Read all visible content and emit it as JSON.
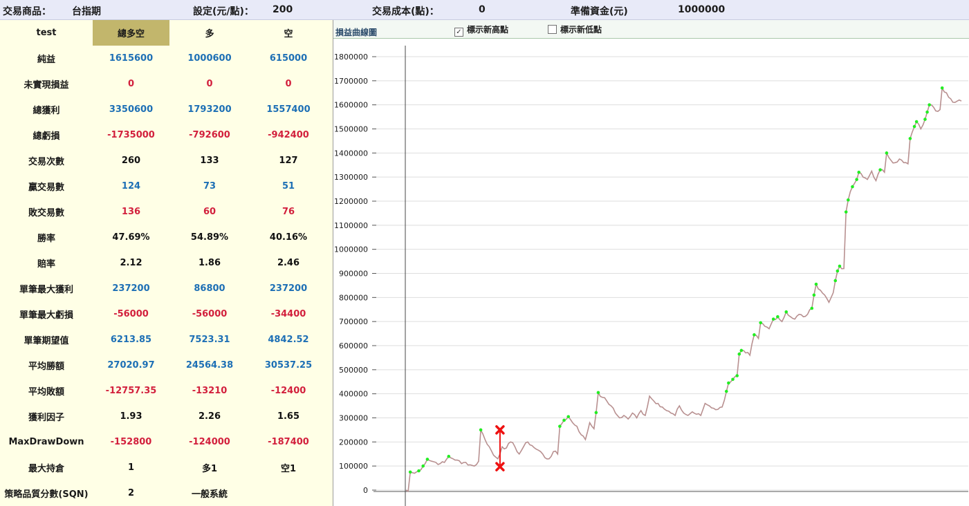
{
  "top": {
    "product_label": "交易商品：",
    "product_value": "台指期",
    "setting_label": "設定(元/點)：",
    "setting_value": "200",
    "cost_label": "交易成本(點)：",
    "cost_value": "0",
    "capital_label": "準備資金(元)",
    "capital_value": "1000000"
  },
  "table": {
    "headers": [
      "test",
      "總多空",
      "多",
      "空"
    ],
    "rows": [
      {
        "label": "純益",
        "values": [
          "1615600",
          "1000600",
          "615000"
        ],
        "tone": "pos"
      },
      {
        "label": "未實現損益",
        "values": [
          "0",
          "0",
          "0"
        ],
        "tone": "neg"
      },
      {
        "label": "總獲利",
        "values": [
          "3350600",
          "1793200",
          "1557400"
        ],
        "tone": "pos"
      },
      {
        "label": "總虧損",
        "values": [
          "-1735000",
          "-792600",
          "-942400"
        ],
        "tone": "neg"
      },
      {
        "label": "交易次數",
        "values": [
          "260",
          "133",
          "127"
        ],
        "tone": "neu"
      },
      {
        "label": "贏交易數",
        "values": [
          "124",
          "73",
          "51"
        ],
        "tone": "pos"
      },
      {
        "label": "敗交易數",
        "values": [
          "136",
          "60",
          "76"
        ],
        "tone": "neg"
      },
      {
        "label": "勝率",
        "values": [
          "47.69%",
          "54.89%",
          "40.16%"
        ],
        "tone": "neu"
      },
      {
        "label": "賠率",
        "values": [
          "2.12",
          "1.86",
          "2.46"
        ],
        "tone": "neu"
      },
      {
        "label": "單筆最大獲利",
        "values": [
          "237200",
          "86800",
          "237200"
        ],
        "tone": "pos"
      },
      {
        "label": "單筆最大虧損",
        "values": [
          "-56000",
          "-56000",
          "-34400"
        ],
        "tone": "neg"
      },
      {
        "label": "單筆期望值",
        "values": [
          "6213.85",
          "7523.31",
          "4842.52"
        ],
        "tone": "pos"
      },
      {
        "label": "平均勝額",
        "values": [
          "27020.97",
          "24564.38",
          "30537.25"
        ],
        "tone": "pos"
      },
      {
        "label": "平均敗額",
        "values": [
          "-12757.35",
          "-13210",
          "-12400"
        ],
        "tone": "neg"
      },
      {
        "label": "獲利因子",
        "values": [
          "1.93",
          "2.26",
          "1.65"
        ],
        "tone": "neu"
      },
      {
        "label": "MaxDrawDown",
        "values": [
          "-152800",
          "-124000",
          "-187400"
        ],
        "tone": "neg"
      },
      {
        "label": "最大持倉",
        "values": [
          "1",
          "多1",
          "空1"
        ],
        "tone": "neu"
      },
      {
        "label": "策略品質分數(SQN)",
        "values": [
          "2",
          "一般系統",
          ""
        ],
        "tone": "neu"
      }
    ]
  },
  "chart_panel": {
    "title": "損益曲線圖",
    "show_new_high_label": "標示新高點",
    "show_new_high_checked": true,
    "show_new_low_label": "標示新低點",
    "show_new_low_checked": false
  },
  "colors": {
    "line": "#b89090",
    "new_high_marker": "#22ee22",
    "drawdown": "#ee1111",
    "positive": "#1d6fb5",
    "negative": "#d21f3c"
  },
  "chart_data": {
    "type": "line",
    "title": "損益曲線圖",
    "xlabel": "",
    "ylabel": "",
    "ylim": [
      0,
      1800000
    ],
    "yticks": [
      0,
      100000,
      200000,
      300000,
      400000,
      500000,
      600000,
      700000,
      800000,
      900000,
      1000000,
      1100000,
      1200000,
      1300000,
      1400000,
      1500000,
      1600000,
      1700000,
      1800000
    ],
    "ytick_labels": [
      "0",
      "100000",
      "200000",
      "300000",
      "400000",
      "500000",
      "600000",
      "700000",
      "800000",
      "900000",
      "1000000",
      "1100000",
      "1200000",
      "1300000",
      "1400000",
      "1500000",
      "1600000",
      "1700000",
      "1800000"
    ],
    "grid": true,
    "x_count": 260,
    "anchors": [
      [
        0,
        0
      ],
      [
        1,
        -5000
      ],
      [
        2,
        75000
      ],
      [
        4,
        70000
      ],
      [
        6,
        80000
      ],
      [
        8,
        100000
      ],
      [
        10,
        128000
      ],
      [
        12,
        120000
      ],
      [
        14,
        115000
      ],
      [
        16,
        110000
      ],
      [
        18,
        115000
      ],
      [
        20,
        140000
      ],
      [
        22,
        130000
      ],
      [
        24,
        125000
      ],
      [
        26,
        110000
      ],
      [
        28,
        115000
      ],
      [
        30,
        105000
      ],
      [
        32,
        100000
      ],
      [
        34,
        120000
      ],
      [
        35,
        250000
      ],
      [
        37,
        210000
      ],
      [
        39,
        180000
      ],
      [
        41,
        145000
      ],
      [
        43,
        130000
      ],
      [
        45,
        180000
      ],
      [
        47,
        175000
      ],
      [
        49,
        200000
      ],
      [
        51,
        180000
      ],
      [
        53,
        150000
      ],
      [
        55,
        180000
      ],
      [
        57,
        200000
      ],
      [
        59,
        185000
      ],
      [
        61,
        170000
      ],
      [
        63,
        160000
      ],
      [
        65,
        135000
      ],
      [
        67,
        130000
      ],
      [
        69,
        160000
      ],
      [
        71,
        150000
      ],
      [
        72,
        265000
      ],
      [
        74,
        290000
      ],
      [
        76,
        305000
      ],
      [
        78,
        280000
      ],
      [
        80,
        265000
      ],
      [
        82,
        230000
      ],
      [
        84,
        210000
      ],
      [
        86,
        280000
      ],
      [
        88,
        255000
      ],
      [
        89,
        322000
      ],
      [
        90,
        405000
      ],
      [
        92,
        385000
      ],
      [
        94,
        370000
      ],
      [
        96,
        350000
      ],
      [
        98,
        320000
      ],
      [
        100,
        300000
      ],
      [
        102,
        310000
      ],
      [
        104,
        295000
      ],
      [
        106,
        320000
      ],
      [
        108,
        300000
      ],
      [
        110,
        330000
      ],
      [
        112,
        310000
      ],
      [
        114,
        390000
      ],
      [
        116,
        370000
      ],
      [
        118,
        360000
      ],
      [
        120,
        345000
      ],
      [
        122,
        330000
      ],
      [
        124,
        320000
      ],
      [
        126,
        310000
      ],
      [
        128,
        350000
      ],
      [
        130,
        320000
      ],
      [
        132,
        310000
      ],
      [
        134,
        325000
      ],
      [
        136,
        315000
      ],
      [
        138,
        310000
      ],
      [
        140,
        360000
      ],
      [
        142,
        350000
      ],
      [
        144,
        340000
      ],
      [
        146,
        335000
      ],
      [
        148,
        345000
      ],
      [
        150,
        410000
      ],
      [
        151,
        445000
      ],
      [
        153,
        460000
      ],
      [
        155,
        475000
      ],
      [
        156,
        565000
      ],
      [
        157,
        580000
      ],
      [
        159,
        570000
      ],
      [
        161,
        560000
      ],
      [
        163,
        645000
      ],
      [
        165,
        630000
      ],
      [
        166,
        695000
      ],
      [
        168,
        680000
      ],
      [
        170,
        670000
      ],
      [
        172,
        710000
      ],
      [
        174,
        720000
      ],
      [
        176,
        700000
      ],
      [
        178,
        740000
      ],
      [
        180,
        720000
      ],
      [
        182,
        710000
      ],
      [
        184,
        730000
      ],
      [
        186,
        720000
      ],
      [
        188,
        730000
      ],
      [
        190,
        755000
      ],
      [
        191,
        810000
      ],
      [
        192,
        855000
      ],
      [
        194,
        830000
      ],
      [
        196,
        810000
      ],
      [
        198,
        780000
      ],
      [
        200,
        820000
      ],
      [
        201,
        870000
      ],
      [
        202,
        910000
      ],
      [
        203,
        930000
      ],
      [
        205,
        920000
      ],
      [
        206,
        1155000
      ],
      [
        207,
        1205000
      ],
      [
        209,
        1260000
      ],
      [
        211,
        1290000
      ],
      [
        212,
        1320000
      ],
      [
        214,
        1300000
      ],
      [
        216,
        1290000
      ],
      [
        218,
        1325000
      ],
      [
        220,
        1285000
      ],
      [
        222,
        1330000
      ],
      [
        224,
        1320000
      ],
      [
        225,
        1400000
      ],
      [
        227,
        1370000
      ],
      [
        229,
        1360000
      ],
      [
        231,
        1375000
      ],
      [
        233,
        1360000
      ],
      [
        235,
        1355000
      ],
      [
        236,
        1460000
      ],
      [
        238,
        1510000
      ],
      [
        239,
        1530000
      ],
      [
        241,
        1500000
      ],
      [
        243,
        1540000
      ],
      [
        244,
        1570000
      ],
      [
        245,
        1600000
      ],
      [
        247,
        1590000
      ],
      [
        248,
        1575000
      ],
      [
        250,
        1580000
      ],
      [
        251,
        1670000
      ],
      [
        253,
        1650000
      ],
      [
        255,
        1625000
      ],
      [
        257,
        1610000
      ],
      [
        259,
        1620000
      ],
      [
        260,
        1615600
      ]
    ],
    "new_high_points": [
      [
        2,
        75000
      ],
      [
        6,
        80000
      ],
      [
        8,
        100000
      ],
      [
        10,
        128000
      ],
      [
        20,
        140000
      ],
      [
        35,
        250000
      ],
      [
        72,
        265000
      ],
      [
        74,
        290000
      ],
      [
        76,
        305000
      ],
      [
        89,
        322000
      ],
      [
        90,
        405000
      ],
      [
        150,
        410000
      ],
      [
        151,
        445000
      ],
      [
        153,
        460000
      ],
      [
        155,
        475000
      ],
      [
        156,
        565000
      ],
      [
        157,
        580000
      ],
      [
        163,
        645000
      ],
      [
        166,
        695000
      ],
      [
        172,
        710000
      ],
      [
        174,
        720000
      ],
      [
        178,
        740000
      ],
      [
        190,
        755000
      ],
      [
        191,
        810000
      ],
      [
        192,
        855000
      ],
      [
        201,
        870000
      ],
      [
        202,
        910000
      ],
      [
        203,
        930000
      ],
      [
        206,
        1155000
      ],
      [
        207,
        1205000
      ],
      [
        209,
        1260000
      ],
      [
        211,
        1290000
      ],
      [
        212,
        1320000
      ],
      [
        222,
        1330000
      ],
      [
        225,
        1400000
      ],
      [
        236,
        1460000
      ],
      [
        238,
        1510000
      ],
      [
        239,
        1530000
      ],
      [
        243,
        1540000
      ],
      [
        244,
        1570000
      ],
      [
        245,
        1600000
      ],
      [
        251,
        1670000
      ]
    ],
    "max_drawdown": {
      "x": 44,
      "top": 250000,
      "bottom": 97200
    }
  }
}
